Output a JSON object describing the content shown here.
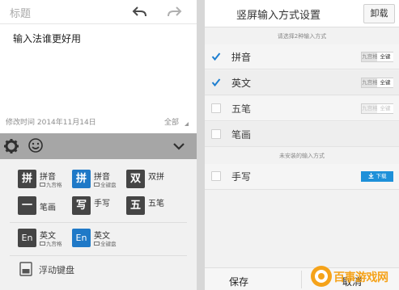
{
  "left_panel": {
    "title_placeholder": "标题",
    "note_text": "输入法谁更好用",
    "modified_time": "修改时间 2014年11月14日",
    "category": "全部",
    "ime_list": [
      {
        "badge": "拼",
        "name": "拼音",
        "sub": "九宫格",
        "style": "dark"
      },
      {
        "badge": "拼",
        "name": "拼音",
        "sub": "全键盘",
        "style": "blue"
      },
      {
        "badge": "双",
        "name": "双拼",
        "sub": "",
        "style": "dark"
      },
      {
        "badge": "一",
        "name": "笔画",
        "sub": "",
        "style": "dark"
      },
      {
        "badge": "写",
        "name": "手写",
        "sub": "",
        "style": "dark"
      },
      {
        "badge": "五",
        "name": "五笔",
        "sub": "",
        "style": "dark"
      },
      {
        "badge": "En",
        "name": "英文",
        "sub": "九宫格",
        "style": "dark"
      },
      {
        "badge": "En",
        "name": "英文",
        "sub": "全键盘",
        "style": "blue"
      }
    ],
    "floating_keyboard": "浮动键盘"
  },
  "right_panel": {
    "title": "竖屏输入方式设置",
    "uninstall": "卸载",
    "select_hint": "请选择2种输入方式",
    "methods": [
      {
        "label": "拼音",
        "checked": true,
        "seg_left": "九宫格",
        "seg_right": "全键",
        "enabled": true
      },
      {
        "label": "英文",
        "checked": true,
        "seg_left": "九宫格",
        "seg_right": "全键",
        "enabled": true
      },
      {
        "label": "五笔",
        "checked": false,
        "seg_left": "九宫格",
        "seg_right": "全键",
        "enabled": false
      },
      {
        "label": "笔画",
        "checked": false
      }
    ],
    "uninstalled_label": "未安装的输入方式",
    "uninstalled": [
      {
        "label": "手写",
        "download": "下载"
      }
    ],
    "save": "保存",
    "cancel": "取消"
  },
  "watermark": "百事游戏网",
  "colors": {
    "accent_blue": "#1f79c7",
    "download_blue": "#1e90d9",
    "check_blue": "#1e7fd0",
    "watermark_orange": "#f5a31a"
  }
}
